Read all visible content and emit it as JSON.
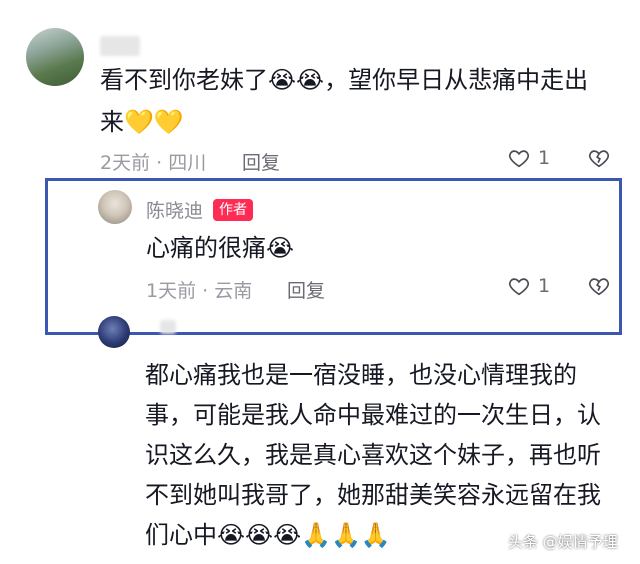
{
  "comment1": {
    "username": "",
    "text_line1": "看不到你老妹了😭😭，望你早日从悲痛中走出",
    "text_line2": "来💛💛",
    "meta": "2天前 · 四川",
    "reply_label": "回复",
    "like_count": "1"
  },
  "reply1": {
    "username": "陈晓迪",
    "author_badge": "作者",
    "text": "心痛的很痛😭",
    "meta": "1天前 · 云南",
    "reply_label": "回复",
    "like_count": "1"
  },
  "comment2": {
    "username": "",
    "lines": [
      "都心痛我也是一宿没睡，也没心情理我的",
      "事，可能是我人命中最难过的一次生日，认",
      "识这么久，我是真心喜欢这个妹子，再也听",
      "不到她叫我哥了，她那甜美笑容永远留在我",
      "们心中😭😭😭🙏🙏🙏"
    ]
  },
  "watermark": "头条 @娱情予理",
  "colors": {
    "highlight_border": "#3d56b2",
    "author_badge_bg": "#fe2c55",
    "meta_gray": "#9a9aa2"
  },
  "icons": {
    "like": "heart-outline-icon",
    "dislike": "broken-heart-icon"
  }
}
